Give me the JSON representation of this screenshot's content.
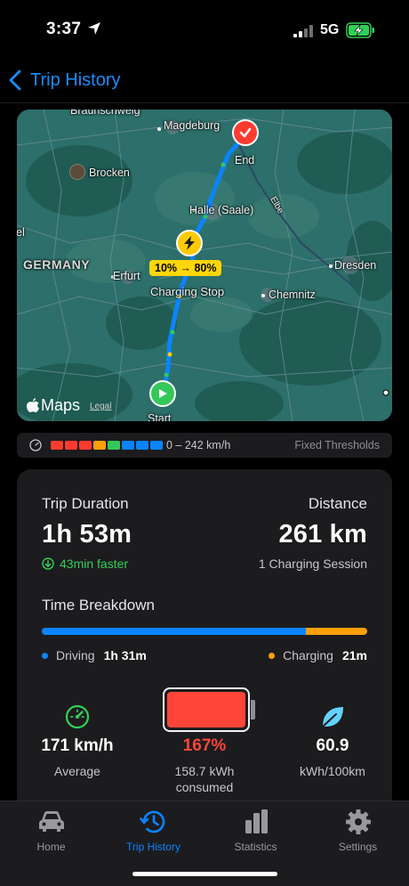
{
  "status_bar": {
    "time": "3:37",
    "network": "5G"
  },
  "nav": {
    "back_label": "Trip History"
  },
  "map": {
    "labels": {
      "braunschweig": "Braunschweig",
      "magdeburg": "Magdeburg",
      "brocken": "Brocken",
      "halle": "Halle (Saale)",
      "elbe": "Elbe",
      "weimar_partial": "el",
      "germany": "GERMANY",
      "erfurt": "Erfurt",
      "dresden": "Dresden",
      "chemnitz": "Chemnitz",
      "end": "End",
      "start": "Start",
      "charging_stop": "Charging Stop"
    },
    "charge_badge": "10% → 80%",
    "brand": "Maps",
    "legal": "Legal"
  },
  "speed_legend": {
    "colors": [
      "#ff3b30",
      "#ff3b30",
      "#ff3b30",
      "#ff9f0a",
      "#34c759",
      "#0a84ff",
      "#0a84ff",
      "#0a84ff"
    ],
    "range": "0 – 242 km/h",
    "mode": "Fixed Thresholds"
  },
  "summary": {
    "duration_label": "Trip Duration",
    "duration_value": "1h 53m",
    "faster_text": "43min faster",
    "distance_label": "Distance",
    "distance_value": "261 km",
    "charging_sessions": "1 Charging Session"
  },
  "breakdown": {
    "title": "Time Breakdown",
    "driving_label": "Driving",
    "driving_value": "1h 31m",
    "charging_label": "Charging",
    "charging_value": "21m",
    "driving_fraction": 0.8125
  },
  "stats": {
    "speed_value": "171 km/h",
    "speed_sub": "Average",
    "battery_value": "167%",
    "battery_sub1": "158.7 kWh",
    "battery_sub2": "consumed",
    "efficiency_value": "60.9",
    "efficiency_sub": "kWh/100km"
  },
  "tabs": [
    {
      "label": "Home",
      "icon": "car-icon"
    },
    {
      "label": "Trip History",
      "icon": "clock-history-icon"
    },
    {
      "label": "Statistics",
      "icon": "bar-chart-icon"
    },
    {
      "label": "Settings",
      "icon": "gear-icon"
    }
  ],
  "colors": {
    "accent": "#0a84ff",
    "driving": "#0a84ff",
    "charging": "#ff9f0a",
    "battery": "#ff453a",
    "positive": "#30d158"
  }
}
